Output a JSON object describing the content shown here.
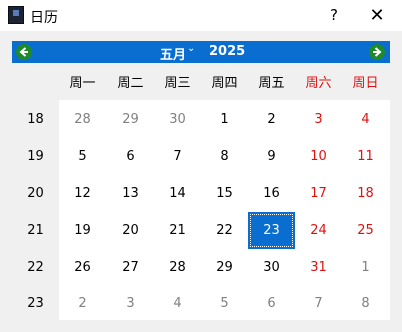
{
  "window": {
    "title": "日历",
    "help_label": "?",
    "close_label": "✕"
  },
  "nav": {
    "month": "五月",
    "year": "2025"
  },
  "colors": {
    "accent": "#0a6dd0",
    "weekend": "#e01010",
    "arrow": "#1f8a2c"
  },
  "weekdays": [
    "周一",
    "周二",
    "周三",
    "周四",
    "周五",
    "周六",
    "周日"
  ],
  "weeks": [
    {
      "num": "18",
      "days": [
        "28",
        "29",
        "30",
        "1",
        "2",
        "3",
        "4"
      ]
    },
    {
      "num": "19",
      "days": [
        "5",
        "6",
        "7",
        "8",
        "9",
        "10",
        "11"
      ]
    },
    {
      "num": "20",
      "days": [
        "12",
        "13",
        "14",
        "15",
        "16",
        "17",
        "18"
      ]
    },
    {
      "num": "21",
      "days": [
        "19",
        "20",
        "21",
        "22",
        "23",
        "24",
        "25"
      ]
    },
    {
      "num": "22",
      "days": [
        "26",
        "27",
        "28",
        "29",
        "30",
        "31",
        "1"
      ]
    },
    {
      "num": "23",
      "days": [
        "2",
        "3",
        "4",
        "5",
        "6",
        "7",
        "8"
      ]
    }
  ],
  "selected_day": "23"
}
